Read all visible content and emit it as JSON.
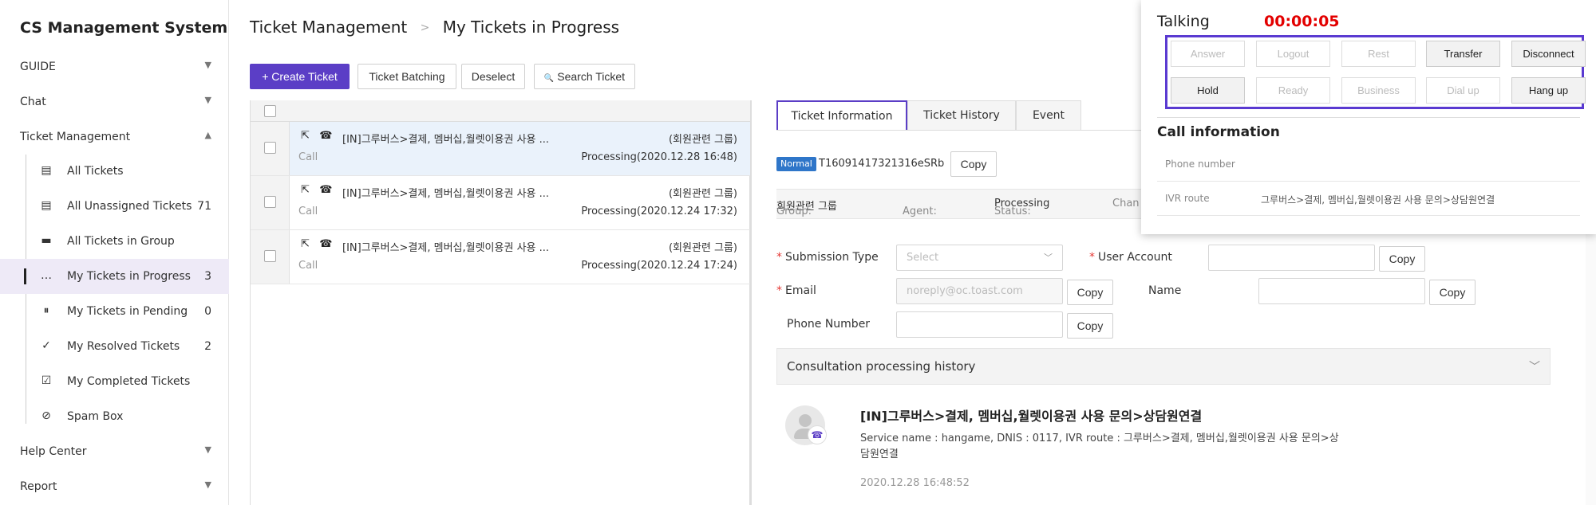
{
  "app": {
    "title": "CS Management System"
  },
  "sidebar": {
    "groups": [
      {
        "label": "GUIDE",
        "caret": "▼"
      },
      {
        "label": "Chat",
        "caret": "▼"
      },
      {
        "label": "Ticket Management",
        "caret": "▲"
      },
      {
        "label": "Help Center",
        "caret": "▼"
      },
      {
        "label": "Report",
        "caret": "▼"
      }
    ],
    "items": [
      {
        "label": "All Tickets",
        "count": "",
        "icon": "document-icon",
        "glyph": "▤"
      },
      {
        "label": "All Unassigned Tickets",
        "count": "71",
        "icon": "document-icon",
        "glyph": "▤"
      },
      {
        "label": "All Tickets in Group",
        "count": "",
        "icon": "folder-icon",
        "glyph": "▬"
      },
      {
        "label": "My Tickets in Progress",
        "count": "3",
        "icon": "chat-dots-icon",
        "glyph": "…"
      },
      {
        "label": "My Tickets in Pending",
        "count": "0",
        "icon": "pause-circle-icon",
        "glyph": "⏸"
      },
      {
        "label": "My Resolved Tickets",
        "count": "2",
        "icon": "user-check-icon",
        "glyph": "✓"
      },
      {
        "label": "My Completed Tickets",
        "count": "",
        "icon": "checkbox-icon",
        "glyph": "☑"
      },
      {
        "label": "Spam Box",
        "count": "",
        "icon": "block-icon",
        "glyph": "⊘"
      }
    ]
  },
  "header": {
    "breadcrumb_parent": "Ticket Management",
    "breadcrumb_sep": ">",
    "breadcrumb_current": "My Tickets in Progress"
  },
  "toolbar": {
    "create": "+ Create Ticket",
    "batching": "Ticket Batching",
    "deselect": "Deselect",
    "search": "Search Ticket",
    "search_icon": "🔍"
  },
  "tickets": [
    {
      "title": "[IN]그루버스>결제, 멤버십,월렛이용권 사용 ...",
      "group": "(회원관련 그룹)",
      "channel": "Call",
      "status": "Processing(2020.12.28 16:48)"
    },
    {
      "title": "[IN]그루버스>결제, 멤버십,월렛이용권 사용 ...",
      "group": "(회원관련 그룹)",
      "channel": "Call",
      "status": "Processing(2020.12.24 17:32)"
    },
    {
      "title": "[IN]그루버스>결제, 멤버십,월렛이용권 사용 ...",
      "group": "(회원관련 그룹)",
      "channel": "Call",
      "status": "Processing(2020.12.24 17:24)"
    }
  ],
  "detail": {
    "tabs": [
      "Ticket Information",
      "Ticket History",
      "Event"
    ],
    "priority_badge": "Normal",
    "ticket_id": "T16091417321316eSRb",
    "copy": "Copy",
    "info": {
      "group_label": "Group:",
      "group_value": "회원관련 그룹",
      "agent_label": "Agent:",
      "agent_value": "",
      "status_label": "Status:",
      "status_value": "Processing",
      "channel_label": "Chan"
    },
    "form": {
      "submission_type_label": "Submission Type",
      "submission_type_placeholder": "Select",
      "user_account_label": "User Account",
      "user_account_value": "",
      "email_label": "Email",
      "email_value": "noreply@oc.toast.com",
      "name_label": "Name",
      "name_value": "",
      "phone_label": "Phone Number",
      "phone_value": ""
    },
    "history": {
      "section_title": "Consultation processing history",
      "entry_title": "[IN]그루버스>결제, 멤버십,월렛이용권 사용 문의>상담원연결",
      "entry_desc": "Service name : hangame, DNIS : 0117, IVR route : 그루버스>결제, 멤버십,월렛이용권 사용 문의>상담원연결",
      "entry_date": "2020.12.28 16:48:52"
    }
  },
  "call_popup": {
    "state": "Talking",
    "timer": "00:00:05",
    "buttons_row1": [
      {
        "label": "Answer",
        "enabled": false
      },
      {
        "label": "Logout",
        "enabled": false
      },
      {
        "label": "Rest",
        "enabled": false
      },
      {
        "label": "Transfer",
        "enabled": true
      },
      {
        "label": "Disconnect",
        "enabled": true
      }
    ],
    "buttons_row2": [
      {
        "label": "Hold",
        "enabled": true
      },
      {
        "label": "Ready",
        "enabled": false
      },
      {
        "label": "Business",
        "enabled": false
      },
      {
        "label": "Dial up",
        "enabled": false
      },
      {
        "label": "Hang up",
        "enabled": true
      }
    ],
    "info_title": "Call information",
    "phone_number_label": "Phone number",
    "phone_number_value": "",
    "ivr_route_label": "IVR route",
    "ivr_route_value": "그루버스>결제, 멤버십,월렛이용권 사용 문의>상담원연결"
  },
  "colors": {
    "accent": "#5b3ec6",
    "highlight_box": "#5a3ad1",
    "timer": "#e30000",
    "badge": "#2f76c9"
  }
}
